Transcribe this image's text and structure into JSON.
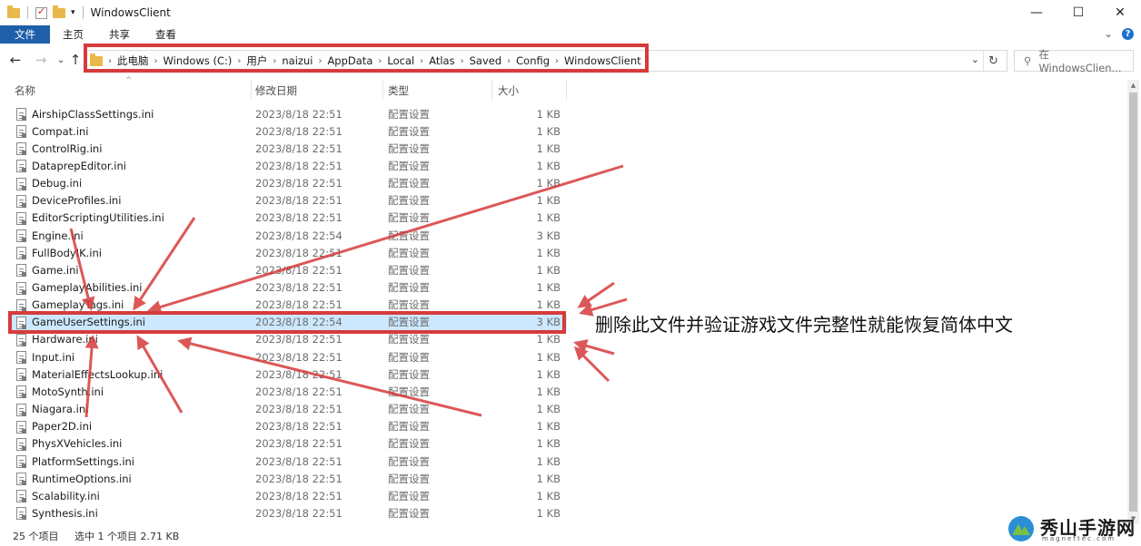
{
  "window": {
    "title": "WindowsClient",
    "controls": {
      "minimize": "—",
      "maximize": "☐",
      "close": "✕"
    }
  },
  "ribbon": {
    "tabs": [
      "文件",
      "主页",
      "共享",
      "查看"
    ],
    "expand_icon": "⌄",
    "help_icon": "?"
  },
  "nav": {
    "back": "←",
    "forward": "→",
    "recent": "⌄",
    "up": "↑"
  },
  "address": {
    "crumbs": [
      "此电脑",
      "Windows (C:)",
      "用户",
      "naizui",
      "AppData",
      "Local",
      "Atlas",
      "Saved",
      "Config",
      "WindowsClient"
    ],
    "dropdown": "⌄",
    "refresh": "↻"
  },
  "search": {
    "placeholder": "在 WindowsClien..."
  },
  "columns": {
    "name": "名称",
    "date": "修改日期",
    "type": "类型",
    "size": "大小"
  },
  "files": [
    {
      "name": "AirshipClassSettings.ini",
      "date": "2023/8/18 22:51",
      "type": "配置设置",
      "size": "1 KB"
    },
    {
      "name": "Compat.ini",
      "date": "2023/8/18 22:51",
      "type": "配置设置",
      "size": "1 KB"
    },
    {
      "name": "ControlRig.ini",
      "date": "2023/8/18 22:51",
      "type": "配置设置",
      "size": "1 KB"
    },
    {
      "name": "DataprepEditor.ini",
      "date": "2023/8/18 22:51",
      "type": "配置设置",
      "size": "1 KB"
    },
    {
      "name": "Debug.ini",
      "date": "2023/8/18 22:51",
      "type": "配置设置",
      "size": "1 KB"
    },
    {
      "name": "DeviceProfiles.ini",
      "date": "2023/8/18 22:51",
      "type": "配置设置",
      "size": "1 KB"
    },
    {
      "name": "EditorScriptingUtilities.ini",
      "date": "2023/8/18 22:51",
      "type": "配置设置",
      "size": "1 KB"
    },
    {
      "name": "Engine.ini",
      "date": "2023/8/18 22:54",
      "type": "配置设置",
      "size": "3 KB"
    },
    {
      "name": "FullBodyIK.ini",
      "date": "2023/8/18 22:51",
      "type": "配置设置",
      "size": "1 KB"
    },
    {
      "name": "Game.ini",
      "date": "2023/8/18 22:51",
      "type": "配置设置",
      "size": "1 KB"
    },
    {
      "name": "GameplayAbilities.ini",
      "date": "2023/8/18 22:51",
      "type": "配置设置",
      "size": "1 KB"
    },
    {
      "name": "GameplayTags.ini",
      "date": "2023/8/18 22:51",
      "type": "配置设置",
      "size": "1 KB"
    },
    {
      "name": "GameUserSettings.ini",
      "date": "2023/8/18 22:54",
      "type": "配置设置",
      "size": "3 KB"
    },
    {
      "name": "Hardware.ini",
      "date": "2023/8/18 22:51",
      "type": "配置设置",
      "size": "1 KB"
    },
    {
      "name": "Input.ini",
      "date": "2023/8/18 22:51",
      "type": "配置设置",
      "size": "1 KB"
    },
    {
      "name": "MaterialEffectsLookup.ini",
      "date": "2023/8/18 22:51",
      "type": "配置设置",
      "size": "1 KB"
    },
    {
      "name": "MotoSynth.ini",
      "date": "2023/8/18 22:51",
      "type": "配置设置",
      "size": "1 KB"
    },
    {
      "name": "Niagara.ini",
      "date": "2023/8/18 22:51",
      "type": "配置设置",
      "size": "1 KB"
    },
    {
      "name": "Paper2D.ini",
      "date": "2023/8/18 22:51",
      "type": "配置设置",
      "size": "1 KB"
    },
    {
      "name": "PhysXVehicles.ini",
      "date": "2023/8/18 22:51",
      "type": "配置设置",
      "size": "1 KB"
    },
    {
      "name": "PlatformSettings.ini",
      "date": "2023/8/18 22:51",
      "type": "配置设置",
      "size": "1 KB"
    },
    {
      "name": "RuntimeOptions.ini",
      "date": "2023/8/18 22:51",
      "type": "配置设置",
      "size": "1 KB"
    },
    {
      "name": "Scalability.ini",
      "date": "2023/8/18 22:51",
      "type": "配置设置",
      "size": "1 KB"
    },
    {
      "name": "Synthesis.ini",
      "date": "2023/8/18 22:51",
      "type": "配置设置",
      "size": "1 KB"
    }
  ],
  "selected_file": "GameUserSettings.ini",
  "status": {
    "count": "25 个项目",
    "selection": "选中 1 个项目  2.71 KB"
  },
  "annotation": "删除此文件并验证游戏文件完整性就能恢复简体中文",
  "watermark": {
    "name": "秀山手游网",
    "url": "magnettec.com"
  },
  "colors": {
    "highlight_red": "#d63b3b",
    "selection_blue": "#cce8ff",
    "file_tab_blue": "#1f5fa9"
  }
}
